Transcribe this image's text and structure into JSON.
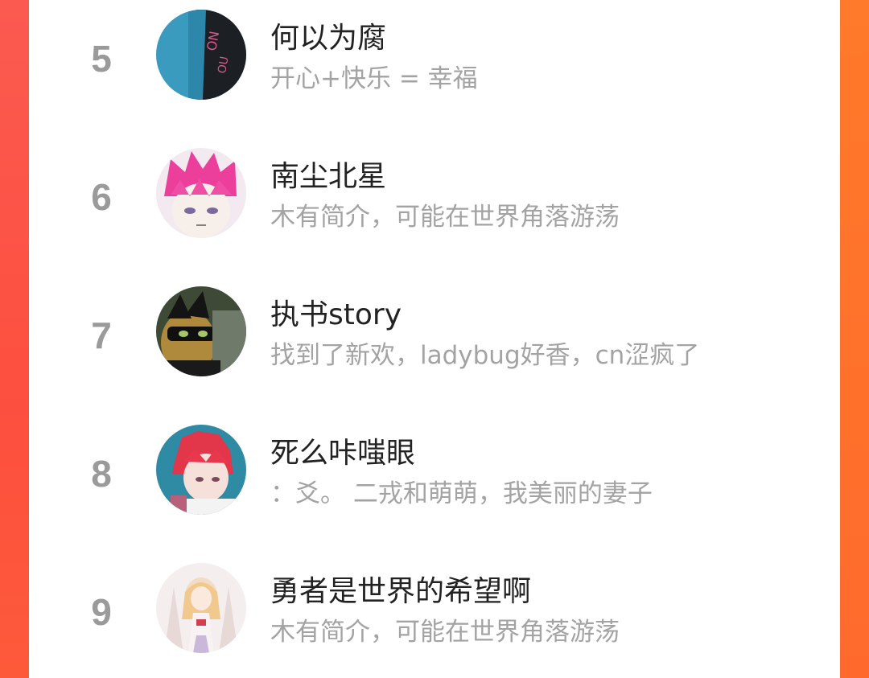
{
  "colors": {
    "left_edge": "#fd4f3f",
    "right_edge": "#ff7a2a",
    "rank_text": "#9a9a9a",
    "name_text": "#222222",
    "desc_text": "#a3a3a3"
  },
  "ranking": {
    "items": [
      {
        "rank": "5",
        "name": "何以为腐",
        "desc": "开心+快乐 = 幸福",
        "avatar": "avatar-teal-shirt"
      },
      {
        "rank": "6",
        "name": "南尘北星",
        "desc": "木有简介，可能在世界角落游荡",
        "avatar": "avatar-pink-hair-anime"
      },
      {
        "rank": "7",
        "name": "执书story",
        "desc": "找到了新欢，ladybug好香，cn涩疯了",
        "avatar": "avatar-black-cat-mask"
      },
      {
        "rank": "8",
        "name": "死么咔嗤眼",
        "desc": "：爻。 二戎和萌萌，我美丽的妻子",
        "avatar": "avatar-red-hair-anime"
      },
      {
        "rank": "9",
        "name": "勇者是世界的希望啊",
        "desc": "木有简介，可能在世界角落游荡",
        "avatar": "avatar-light-fantasy"
      }
    ]
  }
}
